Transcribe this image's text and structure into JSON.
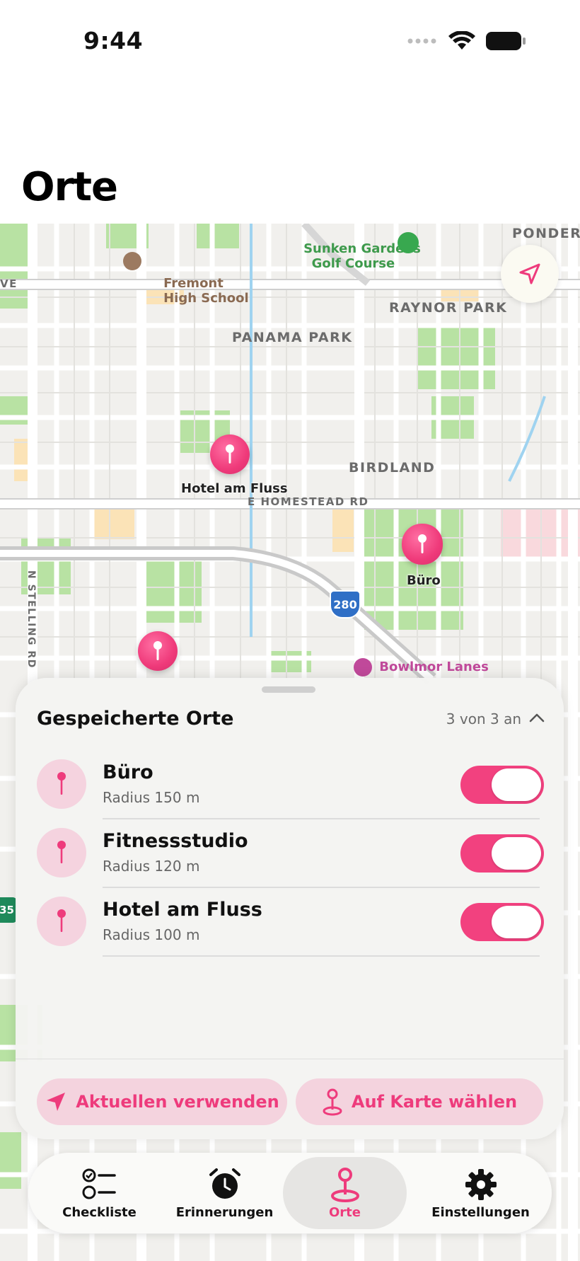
{
  "status_bar": {
    "time": "9:44"
  },
  "header": {
    "title": "Orte"
  },
  "map": {
    "labels": {
      "fremont": "Fremont\nHigh School",
      "sunken": "Sunken Gardens\nGolf Course",
      "ponderosa": "PONDEROS",
      "raynor": "RAYNOR PARK",
      "panama": "PANAMA PARK",
      "birdland": "BIRDLAND",
      "homestead": "E HOMESTEAD RD",
      "stelling": "N STELLING RD",
      "bowlmor": "Bowlmor Lanes",
      "ve": "VE",
      "highway": "280",
      "shield35": "35"
    },
    "pins": [
      {
        "label": "Hotel am Fluss"
      },
      {
        "label": "Büro"
      },
      {
        "label": ""
      }
    ],
    "colors": {
      "accent": "#ee3b7c",
      "park": "#b9e3a2",
      "road": "#ffffff"
    }
  },
  "sheet": {
    "title": "Gespeicherte Orte",
    "count": "3 von 3 an",
    "places": [
      {
        "name": "Büro",
        "radius": "Radius 150 m",
        "enabled": true
      },
      {
        "name": "Fitnessstudio",
        "radius": "Radius 120 m",
        "enabled": true
      },
      {
        "name": "Hotel am Fluss",
        "radius": "Radius 100 m",
        "enabled": true
      }
    ],
    "actions": {
      "use_current": "Aktuellen verwenden",
      "pick_on_map": "Auf Karte wählen"
    }
  },
  "tab_bar": {
    "tabs": [
      {
        "label": "Checkliste",
        "icon": "checklist-icon",
        "active": false
      },
      {
        "label": "Erinnerungen",
        "icon": "alarm-clock-icon",
        "active": false
      },
      {
        "label": "Orte",
        "icon": "map-pin-icon",
        "active": true
      },
      {
        "label": "Einstellungen",
        "icon": "gear-icon",
        "active": false
      }
    ]
  }
}
